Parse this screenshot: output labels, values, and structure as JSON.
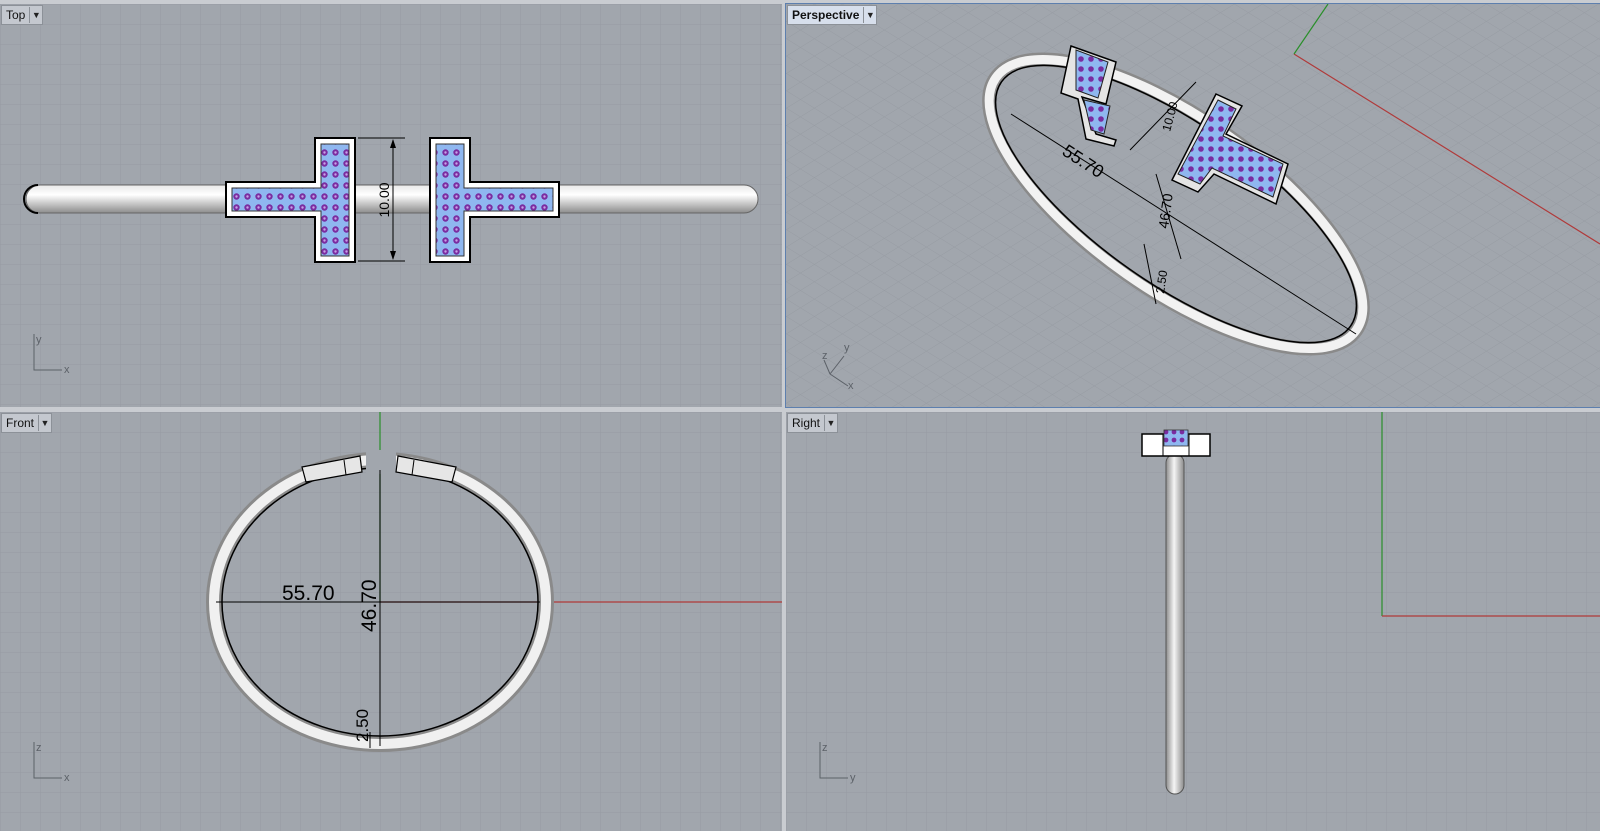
{
  "viewports": {
    "top": {
      "title": "Top",
      "axis_h": "x",
      "axis_v": "y",
      "dimension": "10.00"
    },
    "perspective": {
      "title": "Perspective",
      "axis_a": "x",
      "axis_b": "y",
      "axis_c": "z",
      "dim_width": "55.70",
      "dim_height": "46.70",
      "dim_gap": "10.00",
      "dim_thickness": "2.50"
    },
    "front": {
      "title": "Front",
      "axis_h": "x",
      "axis_v": "z",
      "dim_width": "55.70",
      "dim_height": "46.70",
      "dim_thickness": "2.50"
    },
    "right": {
      "title": "Right",
      "axis_h": "y",
      "axis_v": "z"
    }
  },
  "colors": {
    "viewport_bg": "#a1a6ad",
    "grid_minor": "#959aa1",
    "grid_major": "#878c93",
    "x_axis": "#b03a3a",
    "y_axis": "#2a8f2a",
    "gem_fill": "#8fb7f0",
    "gem_dot": "#7a2ca0"
  }
}
